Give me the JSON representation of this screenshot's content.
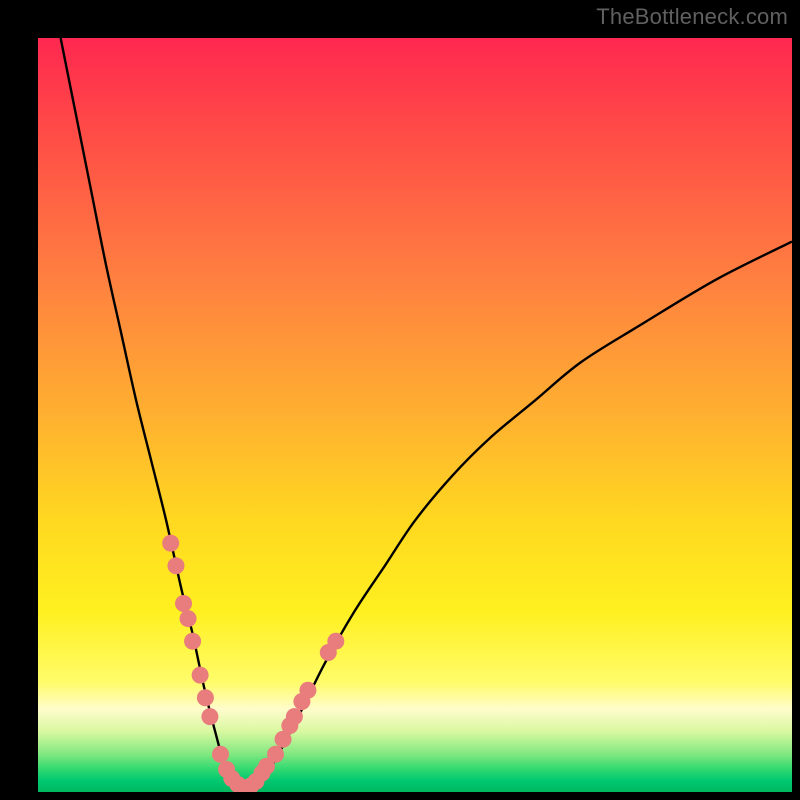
{
  "attribution": "TheBottleneck.com",
  "colors": {
    "curve": "#000000",
    "dot_fill": "#e97c7c",
    "dot_stroke": "#c96060",
    "frame": "#000000"
  },
  "chart_data": {
    "type": "line",
    "title": "",
    "xlabel": "",
    "ylabel": "",
    "xlim": [
      0,
      100
    ],
    "ylim": [
      0,
      100
    ],
    "series": [
      {
        "name": "bottleneck-curve",
        "x": [
          3,
          5,
          7,
          9,
          11,
          13,
          15,
          17,
          19,
          20.5,
          22,
          23.5,
          25,
          27,
          30,
          34,
          38,
          42,
          46,
          50,
          55,
          60,
          66,
          72,
          80,
          90,
          100
        ],
        "y": [
          100,
          90,
          80,
          70,
          61,
          52,
          44,
          36,
          27,
          21,
          14,
          8,
          3,
          0.5,
          2,
          9,
          17,
          24,
          30,
          36,
          42,
          47,
          52,
          57,
          62,
          68,
          73
        ]
      }
    ],
    "highlighted_points": {
      "name": "highlighted-dots",
      "points": [
        {
          "x": 17.6,
          "y": 33
        },
        {
          "x": 18.3,
          "y": 30
        },
        {
          "x": 19.3,
          "y": 25
        },
        {
          "x": 19.9,
          "y": 23
        },
        {
          "x": 20.5,
          "y": 20
        },
        {
          "x": 21.5,
          "y": 15.5
        },
        {
          "x": 22.2,
          "y": 12.5
        },
        {
          "x": 22.8,
          "y": 10
        },
        {
          "x": 24.2,
          "y": 5
        },
        {
          "x": 25.0,
          "y": 3
        },
        {
          "x": 25.7,
          "y": 1.8
        },
        {
          "x": 26.5,
          "y": 1
        },
        {
          "x": 27.3,
          "y": 0.6
        },
        {
          "x": 28.2,
          "y": 0.8
        },
        {
          "x": 28.9,
          "y": 1.4
        },
        {
          "x": 29.7,
          "y": 2.5
        },
        {
          "x": 30.3,
          "y": 3.4
        },
        {
          "x": 31.5,
          "y": 5
        },
        {
          "x": 32.5,
          "y": 7
        },
        {
          "x": 33.4,
          "y": 8.8
        },
        {
          "x": 34.0,
          "y": 10
        },
        {
          "x": 35.0,
          "y": 12
        },
        {
          "x": 35.8,
          "y": 13.5
        },
        {
          "x": 38.5,
          "y": 18.5
        },
        {
          "x": 39.5,
          "y": 20
        }
      ]
    }
  }
}
